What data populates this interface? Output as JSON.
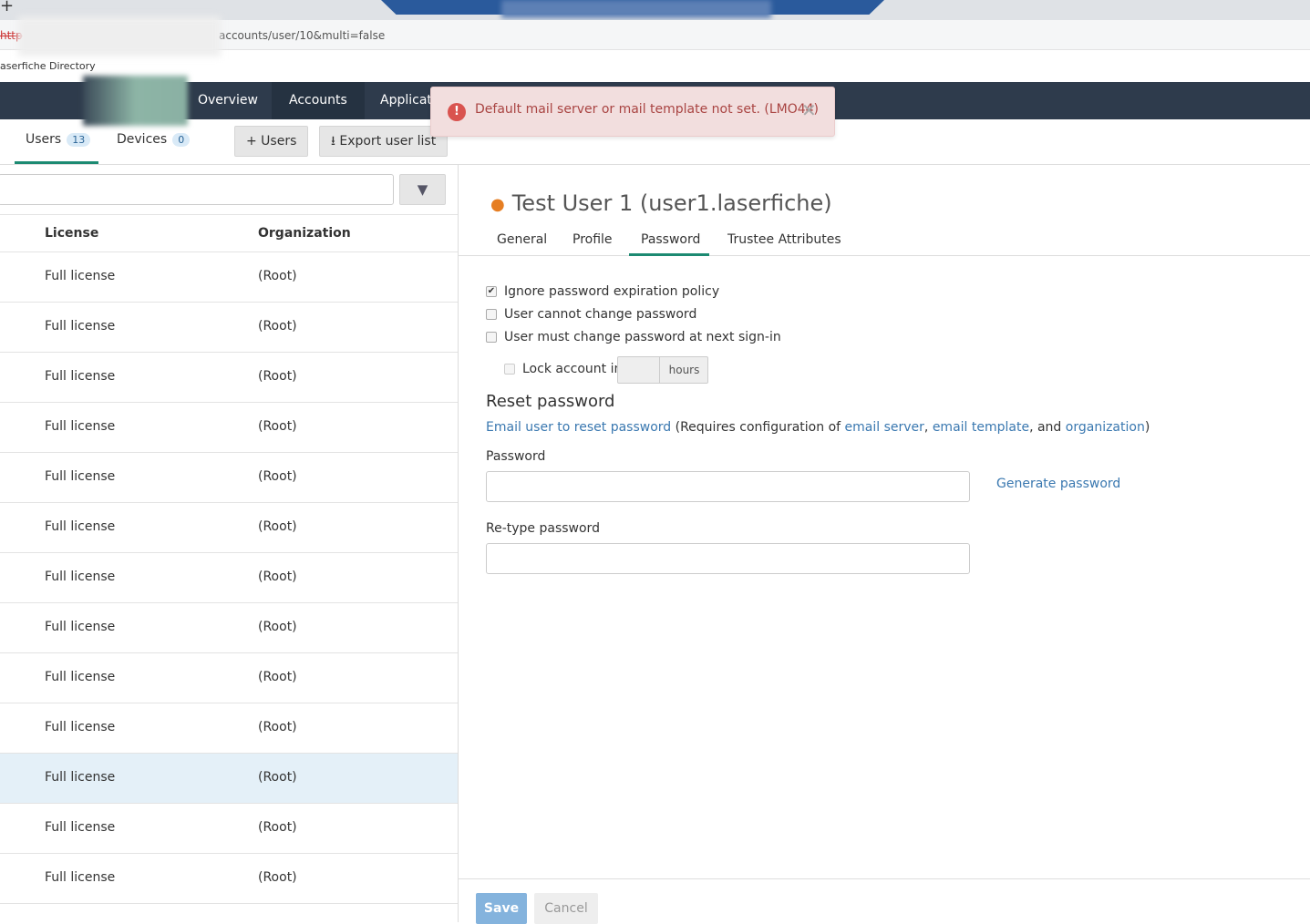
{
  "browser": {
    "url": "accounts/user/10&multi=false",
    "scheme": "http",
    "bookmark": "aserfiche Directory"
  },
  "nav": {
    "items": [
      "Overview",
      "Accounts",
      "Applicati"
    ]
  },
  "toast": {
    "message": "Default mail server or mail template not set. (LMO44)",
    "icon": "!",
    "close": "✕"
  },
  "subtabs": {
    "users": "Users",
    "users_count": "13",
    "devices": "Devices",
    "devices_count": "0",
    "add_users": "+ Users",
    "export": "⭳ Export user list"
  },
  "table": {
    "headers": [
      "License",
      "Organization"
    ],
    "rows": [
      [
        "Full license",
        "(Root)"
      ],
      [
        "Full license",
        "(Root)"
      ],
      [
        "Full license",
        "(Root)"
      ],
      [
        "Full license",
        "(Root)"
      ],
      [
        "Full license",
        "(Root)"
      ],
      [
        "Full license",
        "(Root)"
      ],
      [
        "Full license",
        "(Root)"
      ],
      [
        "Full license",
        "(Root)"
      ],
      [
        "Full license",
        "(Root)"
      ],
      [
        "Full license",
        "(Root)"
      ],
      [
        "Full license",
        "(Root)"
      ],
      [
        "Full license",
        "(Root)"
      ],
      [
        "Full license",
        "(Root)"
      ]
    ],
    "selected_index": 10
  },
  "detail": {
    "title": "Test User 1 (user1.laserfiche)",
    "status_color": "#e67e22",
    "tabs": [
      "General",
      "Profile",
      "Password",
      "Trustee Attributes"
    ],
    "active_tab": "Password",
    "options": [
      {
        "label": "Ignore password expiration policy",
        "checked": true
      },
      {
        "label": "User cannot change password",
        "checked": false
      },
      {
        "label": "User must change password at next sign-in",
        "checked": false
      }
    ],
    "lock_label": "Lock account in",
    "lock_value": "",
    "hours": "hours",
    "reset_heading": "Reset password",
    "email_link": "Email user to reset password",
    "req_pre": "(Requires configuration of ",
    "email_server": "email server",
    "sep1": ", ",
    "email_template": "email template",
    "sep2": ", and ",
    "organization": "organization",
    "req_post": ")",
    "password_label": "Password",
    "password_value": "",
    "generate": "Generate password",
    "retype_label": "Re-type password",
    "retype_value": "",
    "save": "Save",
    "cancel": "Cancel"
  }
}
